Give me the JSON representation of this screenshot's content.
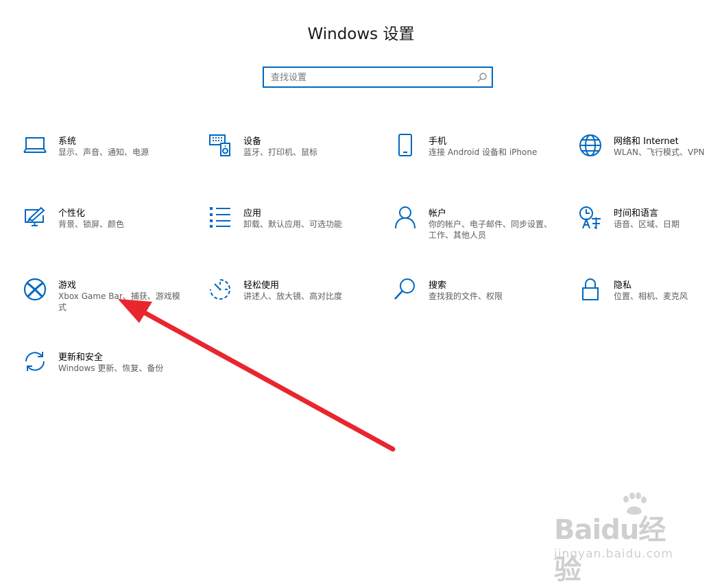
{
  "window": {
    "title": "Windows 设置"
  },
  "search": {
    "placeholder": "查找设置",
    "value": ""
  },
  "tiles": [
    {
      "label": "系统",
      "desc": "显示、声音、通知、电源",
      "icon": "laptop-icon"
    },
    {
      "label": "设备",
      "desc": "蓝牙、打印机、鼠标",
      "icon": "keyboard-speaker-icon"
    },
    {
      "label": "手机",
      "desc": "连接 Android 设备和 iPhone",
      "icon": "phone-icon"
    },
    {
      "label": "网络和 Internet",
      "desc": "WLAN、飞行模式、VPN",
      "icon": "globe-icon"
    },
    {
      "label": "个性化",
      "desc": "背景、锁屏、颜色",
      "icon": "paint-monitor-icon"
    },
    {
      "label": "应用",
      "desc": "卸载、默认应用、可选功能",
      "icon": "apps-list-icon"
    },
    {
      "label": "帐户",
      "desc": "你的帐户、电子邮件、同步设置、工作、其他人员",
      "icon": "person-icon"
    },
    {
      "label": "时间和语言",
      "desc": "语音、区域、日期",
      "icon": "time-language-icon"
    },
    {
      "label": "游戏",
      "desc": "Xbox Game Bar、捕获、游戏模式",
      "icon": "xbox-icon"
    },
    {
      "label": "轻松使用",
      "desc": "讲述人、放大镜、高对比度",
      "icon": "ease-of-access-icon"
    },
    {
      "label": "搜索",
      "desc": "查找我的文件、权限",
      "icon": "search-magnifier-icon"
    },
    {
      "label": "隐私",
      "desc": "位置、相机、麦克风",
      "icon": "lock-icon"
    },
    {
      "label": "更新和安全",
      "desc": "Windows 更新、恢复、备份",
      "icon": "sync-icon"
    }
  ],
  "watermark": {
    "logo": "Baidu经验",
    "url": "jingyan.baidu.com"
  },
  "colors": {
    "accent": "#0067c0",
    "arrow": "#e8262e",
    "description_text": "#5d5d5d"
  }
}
